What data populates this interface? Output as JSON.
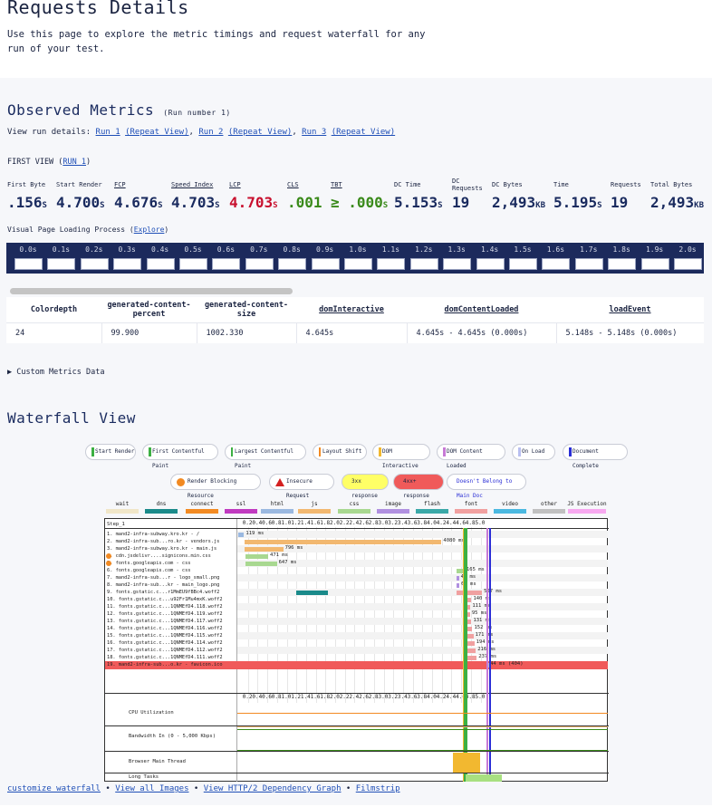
{
  "page": {
    "title": "Requests Details",
    "intro": "Use this page to explore the metric timings and request waterfall for any run of your test."
  },
  "observed": {
    "title": "Observed Metrics",
    "run_number": "(Run number 1)",
    "run_details_label": "View run details:",
    "runs": [
      {
        "run": "Run 1",
        "repeat": "(Repeat View)"
      },
      {
        "run": "Run 2",
        "repeat": "(Repeat View)"
      },
      {
        "run": "Run 3",
        "repeat": "(Repeat View)"
      }
    ],
    "first_view_label": "FIRST VIEW (",
    "first_view_run": "RUN 1",
    "first_view_close": ")",
    "metrics": [
      {
        "label": "First Byte",
        "value": ".156",
        "unit": "S"
      },
      {
        "label": "Start Render",
        "value": "4.700",
        "unit": "S"
      },
      {
        "label": "FCP",
        "value": "4.676",
        "unit": "S"
      },
      {
        "label": "Speed Index",
        "value": "4.703",
        "unit": "S"
      },
      {
        "label": "LCP",
        "value": "4.703",
        "unit": "S"
      },
      {
        "label": "CLS",
        "value": ".001",
        "unit": ""
      },
      {
        "label": "TBT",
        "value": "≥ .000",
        "unit": "S"
      },
      {
        "label": "DC Time",
        "value": "5.153",
        "unit": "S"
      },
      {
        "label": "DC Requests",
        "value": "19",
        "unit": ""
      },
      {
        "label": "DC Bytes",
        "value": "2,493",
        "unit": "KB"
      },
      {
        "label": "Time",
        "value": "5.195",
        "unit": "S"
      },
      {
        "label": "Requests",
        "value": "19",
        "unit": ""
      },
      {
        "label": "Total Bytes",
        "value": "2,493",
        "unit": "KB"
      }
    ],
    "visual_label": "Visual Page Loading Process (",
    "visual_link": "Explore",
    "visual_close": ")",
    "film_times": [
      "0.0s",
      "0.1s",
      "0.2s",
      "0.3s",
      "0.4s",
      "0.5s",
      "0.6s",
      "0.7s",
      "0.8s",
      "0.9s",
      "1.0s",
      "1.1s",
      "1.2s",
      "1.3s",
      "1.4s",
      "1.5s",
      "1.6s",
      "1.7s",
      "1.8s",
      "1.9s",
      "2.0s"
    ]
  },
  "custom_table": {
    "headers": [
      "Colordepth",
      "generated-content-percent",
      "generated-content-size",
      "domInteractive",
      "domContentLoaded",
      "loadEvent"
    ],
    "row": [
      "24",
      "99.900",
      "1002.330",
      "4.645s",
      "4.645s - 4.645s (0.000s)",
      "5.148s - 5.148s (0.000s)"
    ]
  },
  "custom_metrics_label": "▶ Custom Metrics Data",
  "waterfall": {
    "title": "Waterfall View",
    "legend_row1": [
      "Start Render",
      "First Contentful Paint",
      "Largest Contentful Paint",
      "Layout Shift",
      "DOM Interactive",
      "DOM Content Loaded",
      "On Load",
      "Document Complete"
    ],
    "legend_row2": [
      "Render Blocking Resource",
      "Insecure Request",
      "3xx response",
      "4xx+ response",
      "Doesn't Belong to Main Doc"
    ],
    "categories": [
      "wait",
      "dns",
      "connect",
      "ssl",
      "html",
      "js",
      "css",
      "image",
      "flash",
      "font",
      "video",
      "other",
      "JS Execution"
    ],
    "step": "Step_1",
    "ticks": [
      "0.2",
      "0.4",
      "0.6",
      "0.8",
      "1.0",
      "1.2",
      "1.4",
      "1.6",
      "1.8",
      "2.0",
      "2.2",
      "2.4",
      "2.6",
      "2.8",
      "3.0",
      "3.2",
      "3.4",
      "3.6",
      "3.8",
      "4.0",
      "4.2",
      "4.4",
      "4.6",
      "4.8",
      "5.0"
    ],
    "requests": [
      {
        "label": "1. mand2-infra-subway.kro.kr - /",
        "time": "119 ms"
      },
      {
        "label": "2. mand2-infra-sub...ro.kr - vendors.js",
        "time": "4080 ms"
      },
      {
        "label": "3. mand2-infra-subway.kro.kr - main.js",
        "time": "796 ms"
      },
      {
        "label": "4. cdn.jsdelivr....signicons.min.css",
        "time": "471 ms"
      },
      {
        "label": "5. fonts.googleapis.com - css",
        "time": "647 ms"
      },
      {
        "label": "6. fonts.googleapis.com - css",
        "time": "165 ms"
      },
      {
        "label": "7. mand2-infra-sub...r - logo_small.png",
        "time": "45 ms"
      },
      {
        "label": "8. mand2-infra-sub...kr - main_logo.png",
        "time": "62 ms"
      },
      {
        "label": "9. fonts.gstatic.c...r1MmEU9fBBc4.woff2",
        "time": "527 ms"
      },
      {
        "label": "10. fonts.gstatic.c...u92Fr1Mu4mxK.woff2",
        "time": "140 ms"
      },
      {
        "label": "11. fonts.gstatic.c...1QNMEfD4.118.woff2",
        "time": "111 ms"
      },
      {
        "label": "12. fonts.gstatic.c...1QNMEfD4.119.woff2",
        "time": "95 ms"
      },
      {
        "label": "13. fonts.gstatic.c...1QNMEfD4.117.woff2",
        "time": "131 ms"
      },
      {
        "label": "14. fonts.gstatic.c...1QNMEfD4.116.woff2",
        "time": "152 ms"
      },
      {
        "label": "15. fonts.gstatic.c...1QNMEfD4.115.woff2",
        "time": "171 ms"
      },
      {
        "label": "16. fonts.gstatic.c...1QNMEfD4.114.woff2",
        "time": "194 ms"
      },
      {
        "label": "17. fonts.gstatic.c...1QNMEfD4.112.woff2",
        "time": "216 ms"
      },
      {
        "label": "18. fonts.gstatic.c...1QNMEfD4.111.woff2",
        "time": "237 ms"
      },
      {
        "label": "19. mand2-infra-sub...o.kr - favicon.ico",
        "time": "44 ms (404)"
      }
    ],
    "cpu_label": "CPU Utilization",
    "bw_label": "Bandwidth In (0 - 5,000 Kbps)",
    "main_thread_label": "Browser Main Thread",
    "long_tasks_label": "Long Tasks"
  },
  "footer": {
    "links": [
      "customize waterfall",
      "View all Images",
      "View HTTP/2 Dependency Graph",
      "Filmstrip"
    ],
    "sep": "•"
  }
}
